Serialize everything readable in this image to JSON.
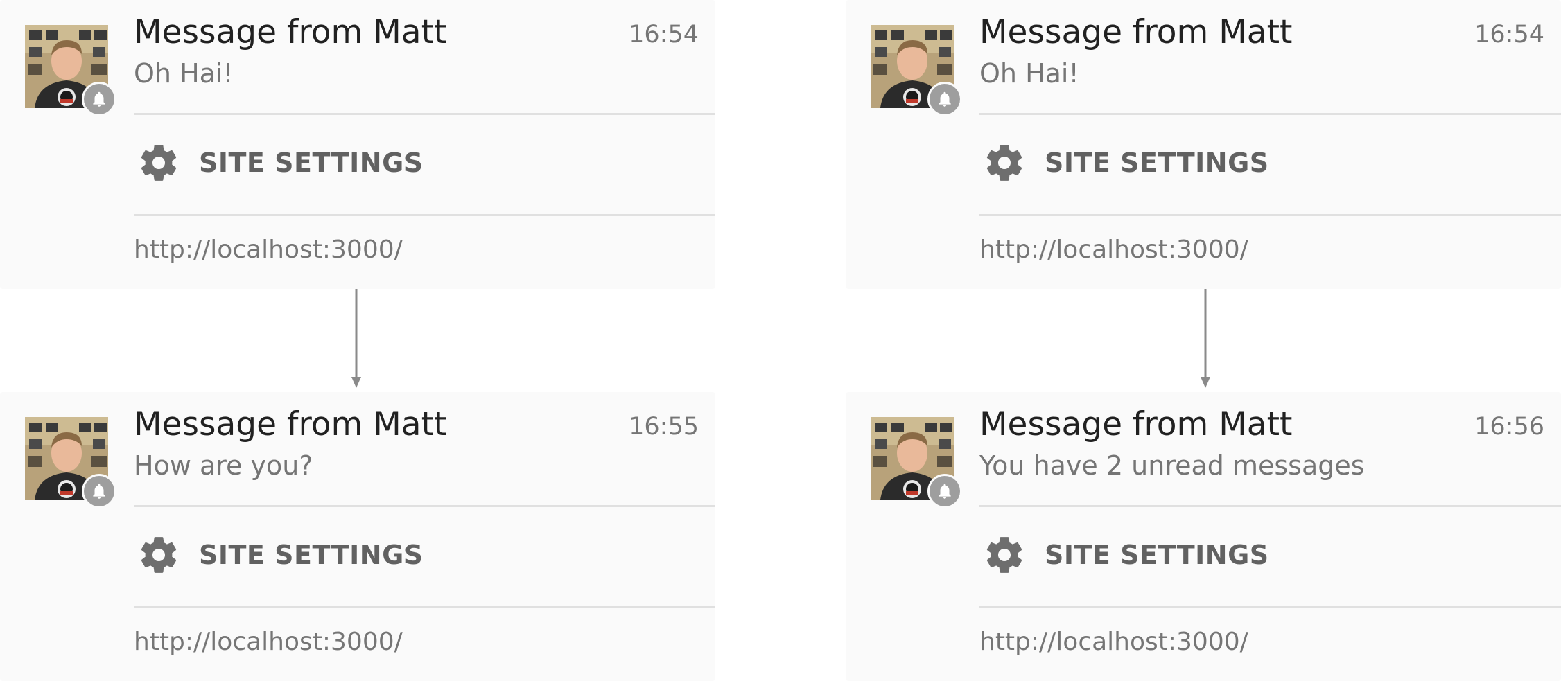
{
  "notifications": [
    {
      "title": "Message from Matt",
      "time": "16:54",
      "body": "Oh Hai!",
      "settings_label": "SITE SETTINGS",
      "origin": "http://localhost:3000/",
      "avatar_icon": "user-photo",
      "badge_icon": "bell-icon",
      "settings_icon": "gear-icon"
    },
    {
      "title": "Message from Matt",
      "time": "16:55",
      "body": "How are you?",
      "settings_label": "SITE SETTINGS",
      "origin": "http://localhost:3000/",
      "avatar_icon": "user-photo",
      "badge_icon": "bell-icon",
      "settings_icon": "gear-icon"
    },
    {
      "title": "Message from Matt",
      "time": "16:54",
      "body": "Oh Hai!",
      "settings_label": "SITE SETTINGS",
      "origin": "http://localhost:3000/",
      "avatar_icon": "user-photo",
      "badge_icon": "bell-icon",
      "settings_icon": "gear-icon"
    },
    {
      "title": "Message from Matt",
      "time": "16:56",
      "body": "You have 2 unread messages",
      "settings_label": "SITE SETTINGS",
      "origin": "http://localhost:3000/",
      "avatar_icon": "user-photo",
      "badge_icon": "bell-icon",
      "settings_icon": "gear-icon"
    }
  ],
  "colors": {
    "card_background": "#fafafa",
    "title_text": "#212121",
    "secondary_text": "#757575",
    "divider": "#e0e0e0",
    "badge": "#9e9e9e",
    "gear": "#6e6e6e",
    "arrow": "#8a8a8a"
  }
}
